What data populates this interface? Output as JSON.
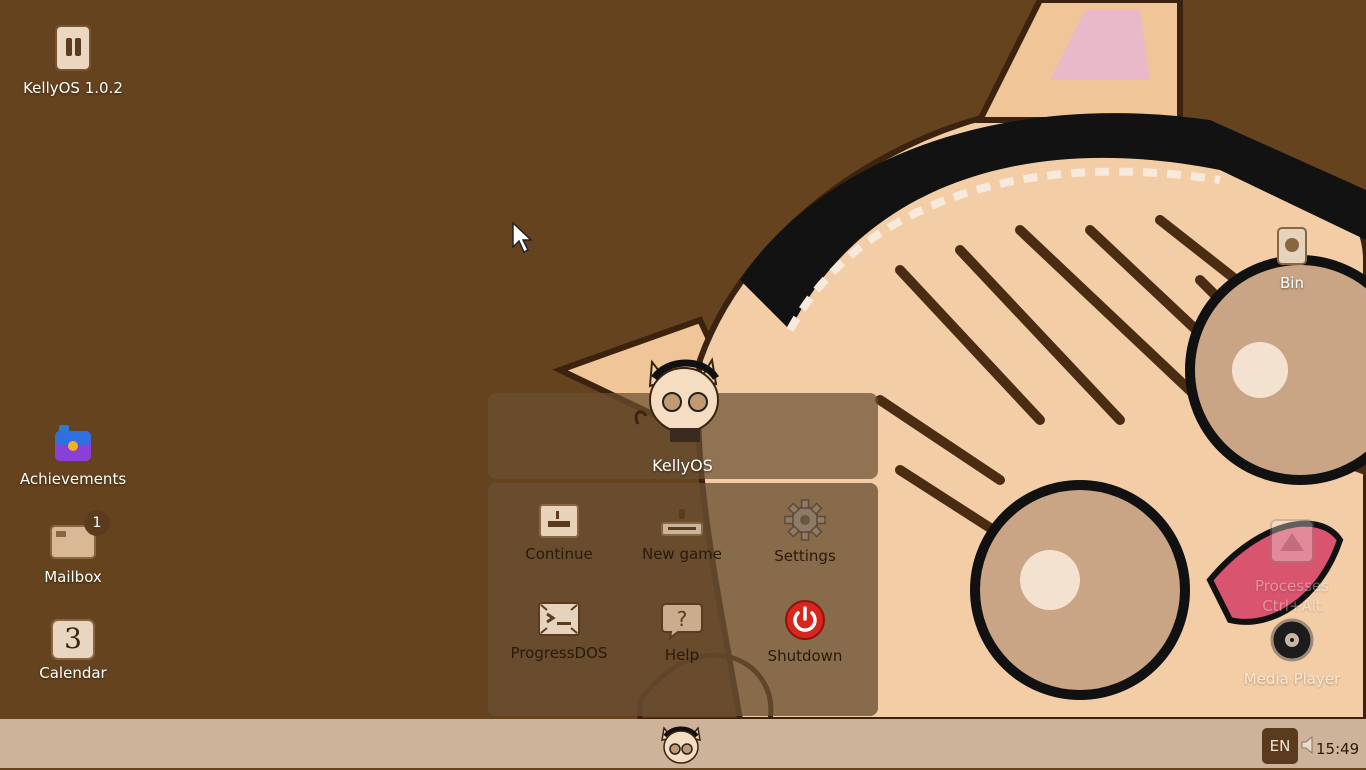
{
  "desktop": {
    "icons_left": [
      {
        "label": "KellyOS 1.0.2",
        "icon": "pause-icon"
      },
      {
        "label": "Achievements",
        "icon": "briefcase-icon"
      },
      {
        "label": "Mailbox",
        "icon": "mail-icon",
        "badge": "1"
      },
      {
        "label": "Calendar",
        "icon": "calendar-icon",
        "day": "3"
      }
    ],
    "icons_right": [
      {
        "label": "Bin",
        "icon": "trash-bin-icon"
      },
      {
        "label": "Processes",
        "sublabel": "Ctrl+Alt",
        "icon": "processes-icon"
      },
      {
        "label": "Media Player",
        "icon": "media-player-icon"
      }
    ]
  },
  "start_menu": {
    "user_label": "KellyOS",
    "items": [
      {
        "label": "Continue",
        "icon": "continue-icon"
      },
      {
        "label": "New game",
        "icon": "new-game-icon"
      },
      {
        "label": "Settings",
        "icon": "gear-icon"
      },
      {
        "label": "ProgressDOS",
        "icon": "progressdos-icon"
      },
      {
        "label": "Help",
        "icon": "help-icon"
      },
      {
        "label": "Shutdown",
        "icon": "power-icon"
      }
    ]
  },
  "taskbar": {
    "language": "EN",
    "clock": "15:49",
    "start_icon": "kelly-avatar-icon",
    "volume_icon": "volume-icon"
  },
  "colors": {
    "desktop_bg": "#66431f",
    "taskbar_bg": "#cdb39a",
    "menu_bg": "#6b5032",
    "accent_dark": "#5a3b1e",
    "shutdown_red": "#d8261c"
  }
}
